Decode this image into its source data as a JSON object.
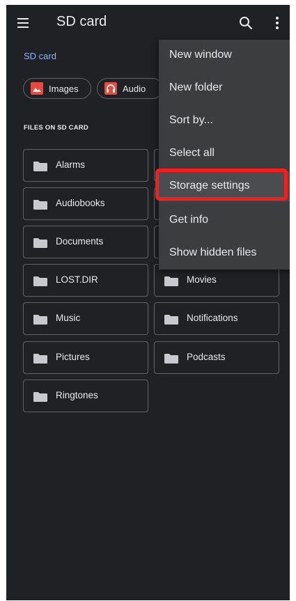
{
  "app_bar": {
    "title": "SD card",
    "menu_icon": "hamburger-menu-icon",
    "search_icon": "search-icon",
    "more_icon": "more-vert-icon"
  },
  "breadcrumb": {
    "label": "SD card"
  },
  "chips": [
    {
      "label": "Images",
      "icon": "image-icon",
      "icon_color": "#e84a3f"
    },
    {
      "label": "Audio",
      "icon": "headphones-icon",
      "icon_color": "#e84a3f"
    }
  ],
  "section_title": "FILES ON SD CARD",
  "folders": [
    {
      "name": "Alarms"
    },
    {
      "name": ""
    },
    {
      "name": "Audiobooks"
    },
    {
      "name": ""
    },
    {
      "name": "Documents"
    },
    {
      "name": ""
    },
    {
      "name": "LOST.DIR"
    },
    {
      "name": "Movies"
    },
    {
      "name": "Music"
    },
    {
      "name": "Notifications"
    },
    {
      "name": "Pictures"
    },
    {
      "name": "Podcasts"
    },
    {
      "name": "Ringtones"
    }
  ],
  "overflow_menu": {
    "items": [
      {
        "label": "New window"
      },
      {
        "label": "New folder"
      },
      {
        "label": "Sort by..."
      },
      {
        "label": "Select all"
      },
      {
        "label": "Storage settings",
        "highlighted": true
      },
      {
        "label": "Get info"
      },
      {
        "label": "Show hidden files"
      }
    ]
  },
  "colors": {
    "background": "#202124",
    "menu_background": "#3b3d3f",
    "accent_blue": "#8ab4f8",
    "text": "#e8eaed",
    "outline": "#5f6368",
    "highlight_red": "#ff1a1a",
    "folder_icon": "#c6c9cd"
  }
}
